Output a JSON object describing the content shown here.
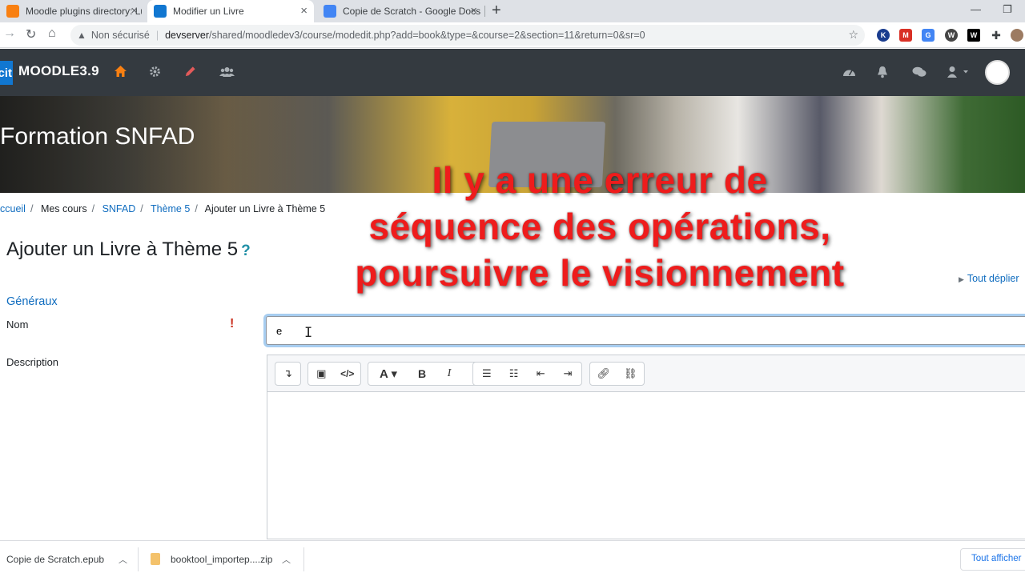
{
  "browser": {
    "tabs": [
      {
        "title": "Moodle plugins directory: Lucim",
        "active": false,
        "favicon_color": "#f98012"
      },
      {
        "title": "Modifier un Livre",
        "active": true,
        "favicon_color": "#1177d1"
      },
      {
        "title": "Copie de Scratch - Google Docs",
        "active": false,
        "favicon_color": "#4285f4"
      }
    ],
    "close_glyph": "×",
    "new_tab_glyph": "+",
    "address": {
      "warning": "Non sécurisé",
      "host": "devserver",
      "path": "/shared/moodledev3/course/modedit.php?add=book&type=&course=2&section=11&return=0&sr=0"
    },
    "extensions": [
      {
        "letter": "K",
        "color": "#1a3d8f"
      },
      {
        "letter": "M",
        "color": "#d93025"
      },
      {
        "letter": "G",
        "color": "#4285f4"
      },
      {
        "letter": "W",
        "color": "#464646"
      },
      {
        "letter": "W",
        "color": "#000000"
      }
    ]
  },
  "navbar": {
    "logo_text": "cit",
    "brand": "MOODLE3.9",
    "accent": "#f98012"
  },
  "banner": {
    "title": "Formation SNFAD"
  },
  "breadcrumb": [
    {
      "label": "ccueil",
      "link": true
    },
    {
      "label": "Mes cours",
      "link": false
    },
    {
      "label": "SNFAD",
      "link": true
    },
    {
      "label": "Thème 5",
      "link": true
    },
    {
      "label": "Ajouter un Livre à Thème 5",
      "link": false
    }
  ],
  "breadcrumb_separator": "/",
  "page": {
    "heading": "Ajouter un Livre à Thème 5",
    "help": "?",
    "expand_all": "Tout déplier",
    "section_legend": "Généraux",
    "name_label": "Nom",
    "name_value": "e",
    "required_mark": "!",
    "description_label": "Description"
  },
  "overlay": {
    "line1": "Il y a une erreur de",
    "line2": "séquence des opérations,",
    "line3": "poursuivre le visionnement",
    "color": "#ee1c1c"
  },
  "downloads": {
    "items": [
      {
        "name": "Copie de Scratch.epub"
      },
      {
        "name": "booktool_importep....zip"
      }
    ],
    "show_all": "Tout afficher"
  }
}
